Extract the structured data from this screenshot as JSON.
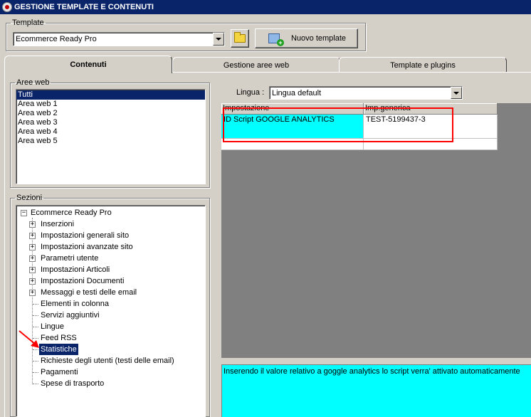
{
  "window": {
    "title": "GESTIONE TEMPLATE E CONTENUTI"
  },
  "template_group": {
    "legend": "Template",
    "selected": "Ecommerce Ready Pro",
    "new_button_label": "Nuovo template"
  },
  "tabs": [
    {
      "label": "Contenuti",
      "active": true
    },
    {
      "label": "Gestione aree web",
      "active": false
    },
    {
      "label": "Template e plugins",
      "active": false
    }
  ],
  "aree_web": {
    "legend": "Aree web",
    "items": [
      "Tutti",
      "Area web 1",
      "Area web 2",
      "Area web 3",
      "Area web 4",
      "Area web 5"
    ],
    "selected_index": 0
  },
  "sezioni": {
    "legend": "Sezioni",
    "root": "Ecommerce Ready Pro",
    "items": [
      {
        "label": "Inserzioni",
        "expandable": true
      },
      {
        "label": "Impostazioni generali sito",
        "expandable": true
      },
      {
        "label": "Impostazioni avanzate sito",
        "expandable": true
      },
      {
        "label": "Parametri utente",
        "expandable": true
      },
      {
        "label": "Impostazioni Articoli",
        "expandable": true
      },
      {
        "label": "Impostazioni Documenti",
        "expandable": true
      },
      {
        "label": "Messaggi e testi delle email",
        "expandable": true
      },
      {
        "label": "Elementi in colonna",
        "expandable": false
      },
      {
        "label": "Servizi aggiuntivi",
        "expandable": false
      },
      {
        "label": "Lingue",
        "expandable": false
      },
      {
        "label": "Feed RSS",
        "expandable": false
      },
      {
        "label": "Statistiche",
        "expandable": false,
        "selected": true
      },
      {
        "label": "Richieste degli utenti (testi delle email)",
        "expandable": false
      },
      {
        "label": "Pagamenti",
        "expandable": false
      },
      {
        "label": "Spese di trasporto",
        "expandable": false
      }
    ]
  },
  "lingua": {
    "label": "Lingua :",
    "selected": "Lingua default"
  },
  "grid": {
    "columns": [
      "Impostazione",
      "Imp.generica"
    ],
    "rows": [
      {
        "impostazione": "ID Script GOOGLE ANALYTICS",
        "valore": "TEST-5199437-3"
      }
    ]
  },
  "description": "Inserendo il valore relativo a goggle analytics lo script verra' attivato automaticamente",
  "colors": {
    "title_bar": "#0a246a",
    "selection": "#0a246a",
    "highlight_cell": "#00ffff",
    "annotation": "#ff0000",
    "face": "#d4d0c8"
  }
}
